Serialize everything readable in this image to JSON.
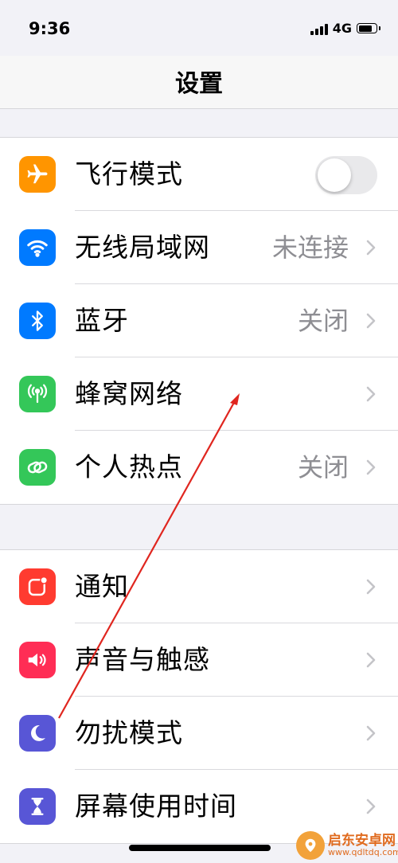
{
  "status_bar": {
    "time": "9:36",
    "network": "4G"
  },
  "nav": {
    "title": "设置"
  },
  "group1": [
    {
      "label": "飞行模式",
      "value": "",
      "icon": "airplane-icon",
      "icon_color": "#ff9500",
      "control": "toggle",
      "toggle_on": false
    },
    {
      "label": "无线局域网",
      "value": "未连接",
      "icon": "wifi-icon",
      "icon_color": "#007aff",
      "control": "chevron"
    },
    {
      "label": "蓝牙",
      "value": "关闭",
      "icon": "bluetooth-icon",
      "icon_color": "#007aff",
      "control": "chevron"
    },
    {
      "label": "蜂窝网络",
      "value": "",
      "icon": "cellular-antenna-icon",
      "icon_color": "#34c759",
      "control": "chevron"
    },
    {
      "label": "个人热点",
      "value": "关闭",
      "icon": "personal-hotspot-icon",
      "icon_color": "#34c759",
      "control": "chevron"
    }
  ],
  "group2": [
    {
      "label": "通知",
      "value": "",
      "icon": "notification-icon",
      "icon_color": "#ff3b30",
      "control": "chevron"
    },
    {
      "label": "声音与触感",
      "value": "",
      "icon": "speaker-icon",
      "icon_color": "#ff2d55",
      "control": "chevron"
    },
    {
      "label": "勿扰模式",
      "value": "",
      "icon": "moon-icon",
      "icon_color": "#5856d6",
      "control": "chevron"
    },
    {
      "label": "屏幕使用时间",
      "value": "",
      "icon": "hourglass-icon",
      "icon_color": "#5856d6",
      "control": "chevron"
    }
  ],
  "annotation": {
    "color": "#e0261f"
  },
  "watermark": {
    "name": "启东安卓网",
    "url": "www.qdltdq.com"
  }
}
